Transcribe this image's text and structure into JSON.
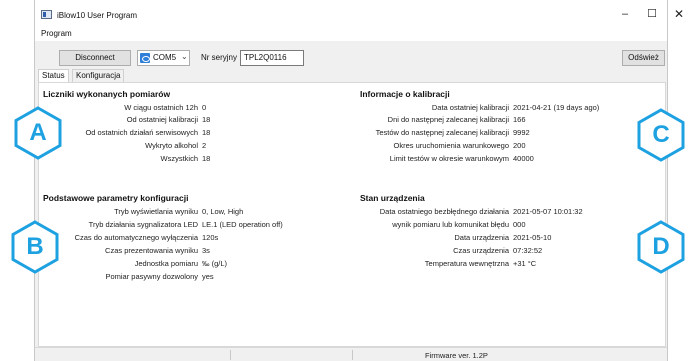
{
  "window": {
    "title": "iBlow10 User Program",
    "minimize_glyph": "–",
    "maximize_glyph": "☐",
    "close_glyph": "✕"
  },
  "menu": {
    "program": "Program"
  },
  "toolbar": {
    "disconnect_label": "Disconnect",
    "port_value": "COM5",
    "serial_label": "Nr seryjny",
    "serial_value": "TPL2Q0116",
    "refresh_label": "Odśwież"
  },
  "tabs": {
    "status": "Status",
    "config": "Konfiguracja"
  },
  "counters": {
    "title": "Liczniki wykonanych pomiarów",
    "rows": [
      {
        "label": "W ciągu ostatnich 12h",
        "value": "0"
      },
      {
        "label": "Od ostatniej kalibracji",
        "value": "18"
      },
      {
        "label": "Od ostatnich działań serwisowych",
        "value": "18"
      },
      {
        "label": "Wykryto alkohol",
        "value": "2"
      },
      {
        "label": "Wszystkich",
        "value": "18"
      }
    ]
  },
  "calibration": {
    "title": "Informacje o kalibracji",
    "rows": [
      {
        "label": "Data ostatniej kalibracji",
        "value": "2021-04-21 (19 days ago)"
      },
      {
        "label": "Dni do następnej zalecanej kalibracji",
        "value": "166"
      },
      {
        "label": "Testów do następnej zalecanej kalibracji",
        "value": "9992"
      },
      {
        "label": "Okres uruchomienia warunkowego",
        "value": "200"
      },
      {
        "label": "Limit testów w okresie warunkowym",
        "value": "40000"
      }
    ]
  },
  "config": {
    "title": "Podstawowe parametry konfiguracji",
    "rows": [
      {
        "label": "Tryb wyświetlania wyniku",
        "value": "0, Low, High"
      },
      {
        "label": "Tryb działania sygnalizatora LED",
        "value": "LE.1 (LED operation off)"
      },
      {
        "label": "Czas do automatycznego wyłączenia",
        "value": "120s"
      },
      {
        "label": "Czas prezentowania wyniku",
        "value": "3s"
      },
      {
        "label": "Jednostka pomiaru",
        "value": "‰ (g/L)"
      },
      {
        "label": "Pomiar pasywny dozwolony",
        "value": "yes"
      }
    ]
  },
  "device": {
    "title": "Stan urządzenia",
    "rows": [
      {
        "label": "Data ostatniego bezbłędnego działania",
        "value": "2021-05-07 10:01:32"
      },
      {
        "label": "wynik pomiaru lub komunikat błędu",
        "value": "000"
      },
      {
        "label": "Data urządzenia",
        "value": "2021-05-10"
      },
      {
        "label": "Czas urządzenia",
        "value": "07:32:52"
      },
      {
        "label": "Temperatura wewnętrzna",
        "value": "+31 °C"
      }
    ]
  },
  "statusbar": {
    "firmware": "Firmware ver. 1.2P"
  },
  "callouts": {
    "a": "A",
    "b": "B",
    "c": "C",
    "d": "D",
    "color": "#1da1e0"
  }
}
